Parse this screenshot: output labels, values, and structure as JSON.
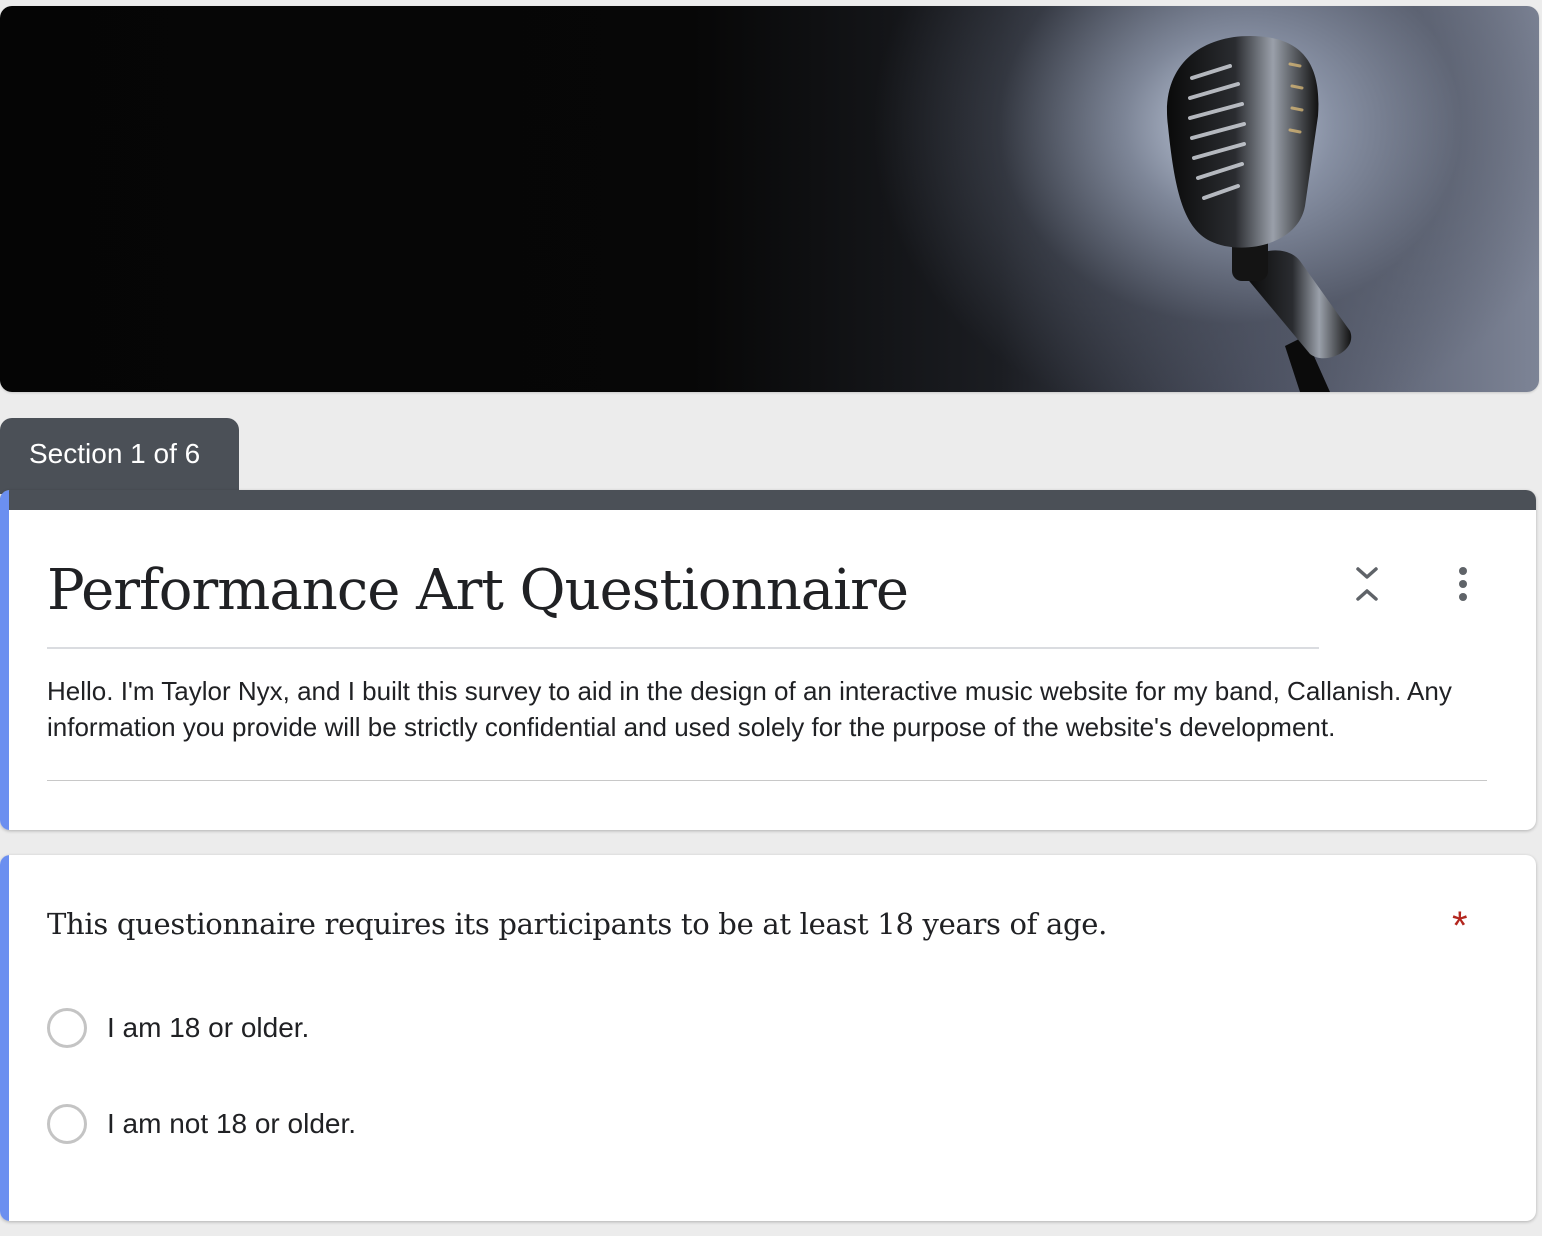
{
  "banner": {
    "image_alt": "Vintage microphone under spotlight"
  },
  "section_tab": {
    "label": "Section 1 of 6"
  },
  "header": {
    "title": "Performance Art Questionnaire",
    "description": "Hello. I'm Taylor Nyx, and I built this survey to aid in the design of an interactive music website for my band, Callanish. Any information you provide will be strictly confidential and used solely for the purpose of the website's development.",
    "collapse_icon": "collapse-expand-icon",
    "more_icon": "more-vert-icon"
  },
  "question": {
    "text": "This questionnaire requires its participants to be at least 18 years of age.",
    "required_mark": "*",
    "options": [
      {
        "label": "I am 18 or older."
      },
      {
        "label": "I am not 18 or older."
      }
    ]
  },
  "colors": {
    "accent": "#6b8ff0",
    "header_bar": "#4b5057",
    "required": "#b3261e",
    "background": "#ececec"
  }
}
